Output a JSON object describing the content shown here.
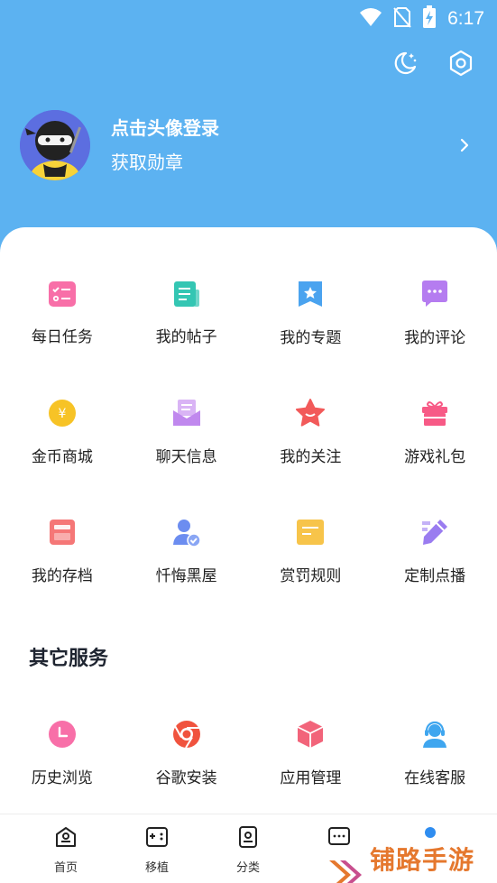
{
  "status_bar": {
    "time": "6:17"
  },
  "top_actions": {
    "night_mode": "moon-icon",
    "settings": "settings-icon"
  },
  "profile": {
    "login_text": "点击头像登录",
    "badge_text": "获取勋章"
  },
  "menu_grid": [
    {
      "label": "每日任务",
      "icon": "task-list-icon",
      "color": "#f86fa8"
    },
    {
      "label": "我的帖子",
      "icon": "posts-icon",
      "color": "#34c6b3"
    },
    {
      "label": "我的专题",
      "icon": "topic-bookmark-icon",
      "color": "#4aa3ef"
    },
    {
      "label": "我的评论",
      "icon": "comment-icon",
      "color": "#b57cf0"
    },
    {
      "label": "金币商城",
      "icon": "coin-icon",
      "color": "#f7c326"
    },
    {
      "label": "聊天信息",
      "icon": "mail-icon",
      "color": "#c088ee"
    },
    {
      "label": "我的关注",
      "icon": "star-icon",
      "color": "#f25a5a"
    },
    {
      "label": "游戏礼包",
      "icon": "gift-icon",
      "color": "#f75a86"
    },
    {
      "label": "我的存档",
      "icon": "archive-icon",
      "color": "#f57777"
    },
    {
      "label": "忏悔黑屋",
      "icon": "user-check-icon",
      "color": "#6c8df0"
    },
    {
      "label": "赏罚规则",
      "icon": "rules-icon",
      "color": "#f7c44a"
    },
    {
      "label": "定制点播",
      "icon": "pencil-icon",
      "color": "#9a7cf0"
    }
  ],
  "other_services": {
    "title": "其它服务",
    "items": [
      {
        "label": "历史浏览",
        "icon": "clock-icon",
        "color": "#f86fa8"
      },
      {
        "label": "谷歌安装",
        "icon": "chrome-icon",
        "color": "#f0533e"
      },
      {
        "label": "应用管理",
        "icon": "cube-icon",
        "color": "#f2647a"
      },
      {
        "label": "在线客服",
        "icon": "customer-service-icon",
        "color": "#3fa6ef"
      }
    ]
  },
  "bottom_nav": [
    {
      "label": "首页",
      "icon": "home-icon"
    },
    {
      "label": "移植",
      "icon": "gamepad-icon"
    },
    {
      "label": "分类",
      "icon": "category-icon"
    },
    {
      "label": "",
      "icon": "chat-icon"
    },
    {
      "label": "",
      "icon": "profile-icon"
    }
  ],
  "watermark": {
    "text": "铺路手游网"
  },
  "colors": {
    "header_blue": "#5cb2f1",
    "watermark_orange": "#e5782e"
  }
}
